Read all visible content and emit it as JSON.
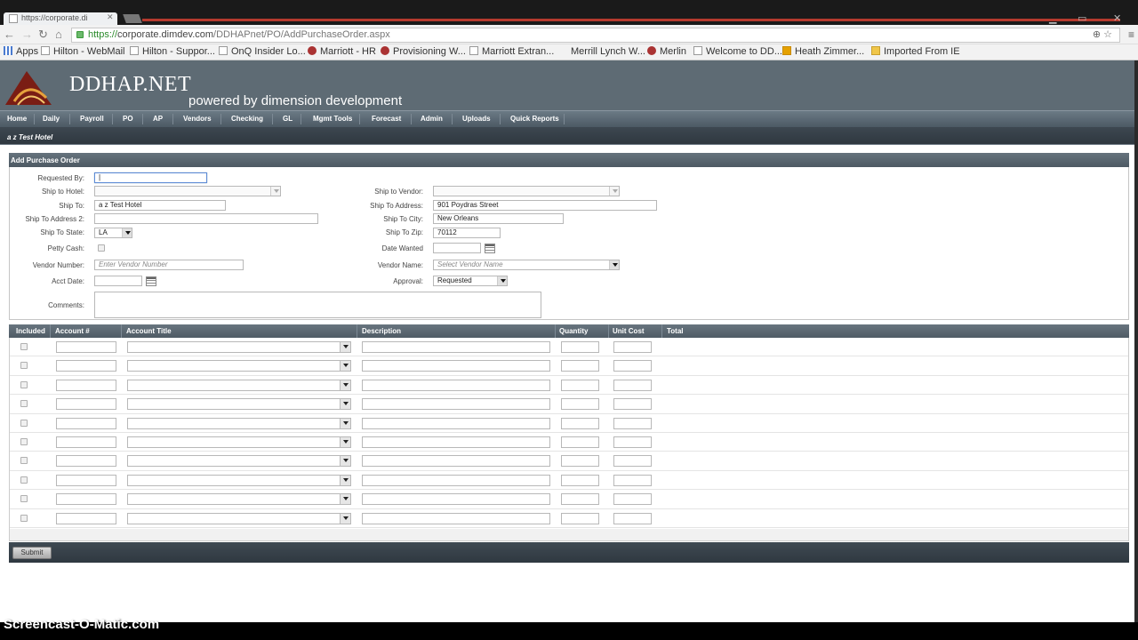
{
  "browser": {
    "tab_title": "https://corporate.di",
    "url_scheme": "https://",
    "url_host": "corporate.dimdev.com",
    "url_path": "/DDHAPnet/PO/AddPurchaseOrder.aspx",
    "bookmarks": [
      {
        "label": "Apps",
        "icon": "apps-grid-icon"
      },
      {
        "label": "Hilton - WebMail",
        "icon": "page-icon"
      },
      {
        "label": "Hilton - Suppor...",
        "icon": "page-icon"
      },
      {
        "label": "OnQ Insider Lo...",
        "icon": "page-icon"
      },
      {
        "label": "Marriott - HR",
        "icon": "marriott-icon"
      },
      {
        "label": "Provisioning W...",
        "icon": "marriott-icon"
      },
      {
        "label": "Marriott Extran...",
        "icon": "page-icon"
      },
      {
        "label": "Merrill Lynch W...",
        "icon": "none"
      },
      {
        "label": "Merlin",
        "icon": "page-icon"
      },
      {
        "label": "Welcome to DD...",
        "icon": "page-icon"
      },
      {
        "label": "Heath Zimmer...",
        "icon": "orange-icon"
      },
      {
        "label": "Imported From IE",
        "icon": "folder-icon"
      }
    ]
  },
  "header": {
    "brand": "DDHAP.NET",
    "tagline": "powered by dimension development"
  },
  "nav": [
    "Home",
    "Daily",
    "Payroll",
    "PO",
    "AP",
    "Vendors",
    "Checking",
    "GL",
    "Mgmt Tools",
    "Forecast",
    "Admin",
    "Uploads",
    "Quick Reports"
  ],
  "hotel": "a z Test Hotel",
  "form": {
    "panel_title": "Add Purchase Order",
    "requested_by_label": "Requested By:",
    "requested_by_value": "|",
    "ship_to_hotel_label": "Ship to Hotel:",
    "ship_to_label": "Ship To:",
    "ship_to_value": "a z Test Hotel",
    "ship_to_address2_label": "Ship To Address 2:",
    "ship_to_state_label": "Ship To State:",
    "ship_to_state_value": "LA",
    "petty_cash_label": "Petty Cash:",
    "vendor_number_label": "Vendor Number:",
    "vendor_number_placeholder": "Enter Vendor Number",
    "acct_date_label": "Acct Date:",
    "comments_label": "Comments:",
    "ship_to_vendor_label": "Ship to Vendor:",
    "ship_to_address_label": "Ship To Address:",
    "ship_to_address_value": "901 Poydras Street",
    "ship_to_city_label": "Ship To City:",
    "ship_to_city_value": "New Orleans",
    "ship_to_zip_label": "Ship To Zip:",
    "ship_to_zip_value": "70112",
    "date_wanted_label": "Date Wanted",
    "vendor_name_label": "Vendor Name:",
    "vendor_name_placeholder": "Select Vendor Name",
    "approval_label": "Approval:",
    "approval_value": "Requested"
  },
  "grid": {
    "columns": [
      "Included",
      "Account #",
      "Account Title",
      "Description",
      "Quantity",
      "Unit Cost",
      "Total"
    ],
    "row_count": 10
  },
  "submit_label": "Submit",
  "watermark": "Screencast-O-Matic.com"
}
